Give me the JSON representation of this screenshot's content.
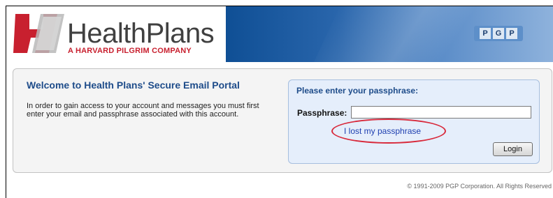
{
  "header": {
    "logo_name": "HealthPlans",
    "logo_tagline": "A HARVARD PILGRIM COMPANY",
    "pgp_letters": [
      "P",
      "G",
      "P"
    ],
    "brand_red": "#c8202f",
    "banner_blue": "#1a5aa0"
  },
  "welcome": {
    "title": "Welcome to Health Plans' Secure Email Portal",
    "text": "In order to gain access to your account and messages you must first enter your email and passphrase associated with this account."
  },
  "login": {
    "heading": "Please enter your passphrase:",
    "passphrase_label": "Passphrase:",
    "passphrase_value": "",
    "lost_link": "I lost my passphrase",
    "login_button": "Login"
  },
  "footer": {
    "copyright": "© 1991-2009 PGP Corporation. All Rights Reserved"
  },
  "icons": {
    "logo_mark": "healthplans-logo-icon",
    "pgp_badge": "pgp-logo-icon"
  }
}
